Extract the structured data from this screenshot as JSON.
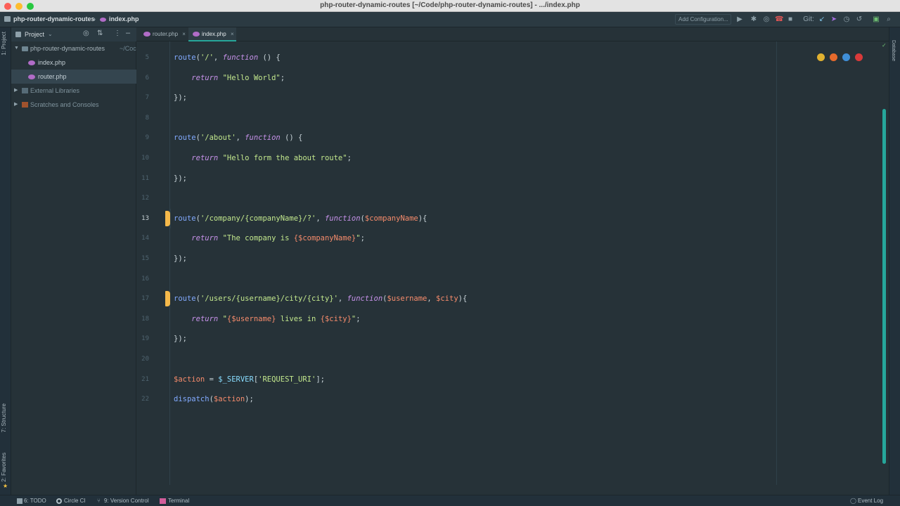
{
  "window": {
    "title": "php-router-dynamic-routes [~/Code/php-router-dynamic-routes] - .../index.php"
  },
  "navbar": {
    "project_crumb": "php-router-dynamic-routes",
    "file_crumb": "index.php",
    "add_configuration": "Add Configuration...",
    "git_label": "Git:"
  },
  "left_tool_tabs": {
    "project": "1: Project",
    "structure": "7: Structure",
    "favorites": "2: Favorites"
  },
  "right_tool_tabs": {
    "database": "Database"
  },
  "project_panel": {
    "view_label": "Project",
    "tree": [
      {
        "label": "php-router-dynamic-routes",
        "suffix": "~/Coc",
        "type": "folder"
      },
      {
        "label": "index.php",
        "type": "php"
      },
      {
        "label": "router.php",
        "type": "php",
        "selected": true
      },
      {
        "label": "External Libraries",
        "type": "library"
      },
      {
        "label": "Scratches and Consoles",
        "type": "scratch"
      }
    ]
  },
  "tabs": [
    {
      "label": "router.php"
    },
    {
      "label": "index.php",
      "active": true
    }
  ],
  "editor": {
    "line_numbers": [
      "5",
      "6",
      "7",
      "8",
      "9",
      "10",
      "11",
      "12",
      "13",
      "14",
      "15",
      "16",
      "17",
      "18",
      "19",
      "20",
      "21",
      "22"
    ],
    "current_line": "13",
    "lines": [
      "route('/', function () {",
      "    return \"Hello World\";",
      "});",
      "",
      "route('/about', function () {",
      "    return \"Hello form the about route\";",
      "});",
      "",
      "route('/company/{companyName}/?', function($companyName){",
      "    return \"The company is {$companyName}\";",
      "});",
      "",
      "route('/users/{username}/city/{city}', function($username, $city){",
      "    return \"{$username} lives in {$city}\";",
      "});",
      "",
      "$action = $_SERVER['REQUEST_URI'];",
      "dispatch($action);"
    ]
  },
  "browser_icons": [
    {
      "name": "chrome",
      "color": "#e0b130"
    },
    {
      "name": "firefox",
      "color": "#e66a2c"
    },
    {
      "name": "safari",
      "color": "#3f8fd8"
    },
    {
      "name": "opera",
      "color": "#d93a3a"
    }
  ],
  "statusbar": {
    "todo": "6: TODO",
    "circleci": "Circle CI",
    "vcs": "9: Version Control",
    "terminal": "Terminal",
    "event_log": "Event Log"
  }
}
